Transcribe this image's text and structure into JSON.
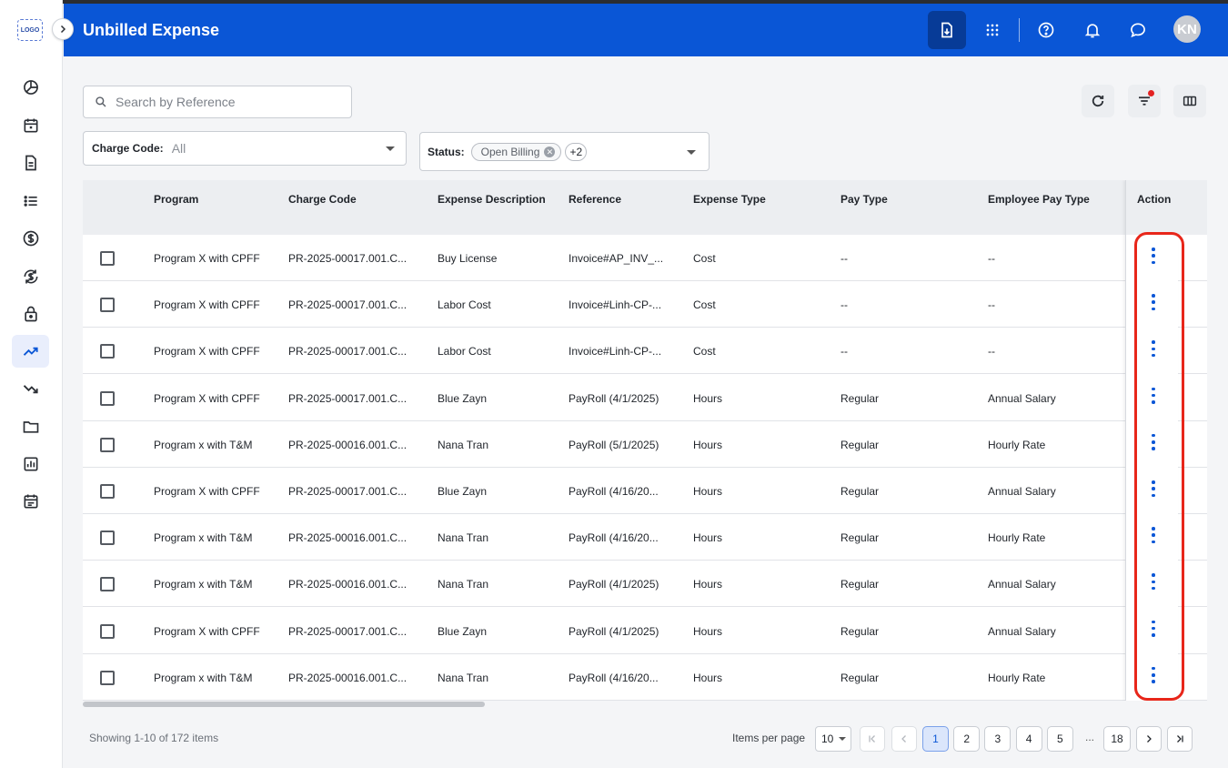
{
  "app": {
    "logo_text": "LOGO",
    "page_title": "Unbilled Expense",
    "user_initials": "KN"
  },
  "sidebar": {
    "items": [
      {
        "icon": "pie-chart-icon"
      },
      {
        "icon": "calendar-icon"
      },
      {
        "icon": "document-icon"
      },
      {
        "icon": "list-icon"
      },
      {
        "icon": "dollar-icon"
      },
      {
        "icon": "dollar-sync-icon"
      },
      {
        "icon": "lock-icon"
      },
      {
        "icon": "trending-up-icon",
        "active": true
      },
      {
        "icon": "trending-down-icon"
      },
      {
        "icon": "folder-icon"
      },
      {
        "icon": "bar-chart-icon"
      },
      {
        "icon": "calendar-event-icon"
      }
    ]
  },
  "search": {
    "placeholder": "Search by Reference",
    "value": ""
  },
  "filters": {
    "charge_code": {
      "label": "Charge Code:",
      "value": "All"
    },
    "status": {
      "label": "Status:",
      "chip": "Open Billing",
      "more": "+2"
    }
  },
  "table": {
    "columns": [
      "Program",
      "Charge Code",
      "Expense Description",
      "Reference",
      "Expense Type",
      "Pay Type",
      "Employee Pay Type"
    ],
    "action_header": "Action",
    "rows": [
      [
        "Program X with CPFF",
        "PR-2025-00017.001.C...",
        "Buy License",
        "Invoice#AP_INV_...",
        "Cost",
        "--",
        "--"
      ],
      [
        "Program X with CPFF",
        "PR-2025-00017.001.C...",
        "Labor Cost",
        "Invoice#Linh-CP-...",
        "Cost",
        "--",
        "--"
      ],
      [
        "Program X with CPFF",
        "PR-2025-00017.001.C...",
        "Labor Cost",
        "Invoice#Linh-CP-...",
        "Cost",
        "--",
        "--"
      ],
      [
        "Program X with CPFF",
        "PR-2025-00017.001.C...",
        "Blue Zayn",
        "PayRoll (4/1/2025)",
        "Hours",
        "Regular",
        "Annual Salary"
      ],
      [
        "Program x with T&M",
        "PR-2025-00016.001.C...",
        "Nana Tran",
        "PayRoll (5/1/2025)",
        "Hours",
        "Regular",
        "Hourly Rate"
      ],
      [
        "Program X with CPFF",
        "PR-2025-00017.001.C...",
        "Blue Zayn",
        "PayRoll (4/16/20...",
        "Hours",
        "Regular",
        "Annual Salary"
      ],
      [
        "Program x with T&M",
        "PR-2025-00016.001.C...",
        "Nana Tran",
        "PayRoll (4/16/20...",
        "Hours",
        "Regular",
        "Hourly Rate"
      ],
      [
        "Program x with T&M",
        "PR-2025-00016.001.C...",
        "Nana Tran",
        "PayRoll (4/1/2025)",
        "Hours",
        "Regular",
        "Annual Salary"
      ],
      [
        "Program X with CPFF",
        "PR-2025-00017.001.C...",
        "Blue Zayn",
        "PayRoll (4/1/2025)",
        "Hours",
        "Regular",
        "Annual Salary"
      ],
      [
        "Program x with T&M",
        "PR-2025-00016.001.C...",
        "Nana Tran",
        "PayRoll (4/16/20...",
        "Hours",
        "Regular",
        "Hourly Rate"
      ]
    ]
  },
  "pagination": {
    "summary": "Showing 1-10 of 172 items",
    "items_per_page_label": "Items per page",
    "items_per_page": "10",
    "pages": [
      "1",
      "2",
      "3",
      "4",
      "5"
    ],
    "current_page": "1",
    "ellipsis": "...",
    "last_page": "18"
  },
  "colors": {
    "header": "#0a56d6",
    "accent": "#0a56d6",
    "highlight": "#e8261a"
  }
}
